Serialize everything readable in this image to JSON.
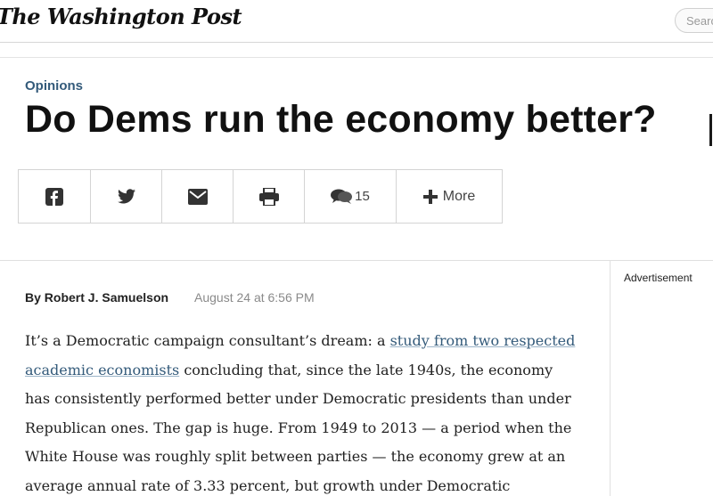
{
  "masthead": {
    "logo_text": "The Washington Post",
    "search_placeholder": "Search"
  },
  "article": {
    "section": "Opinions",
    "headline": "Do Dems run the economy better?",
    "author": "By Robert J. Samuelson",
    "timestamp": "August 24 at 6:56 PM",
    "body": [
      "It’s a Democratic campaign consultant’s dream: a ",
      "study from two respected academic economists",
      " concluding that, since the late 1940s, the economy has consistently performed better under Democratic presidents than under Republican ones. The gap is huge. From 1949 to 2013 — a period when the White House was roughly split between parties — the economy grew at an average annual rate of 3.33 percent, but growth under Democratic"
    ]
  },
  "share_bar": {
    "comment_count": "15",
    "more_label": "More",
    "icons": [
      "facebook-icon",
      "twitter-icon",
      "email-icon",
      "print-icon",
      "comments-icon",
      "plus-icon"
    ]
  },
  "sidebar": {
    "ad_label": "Advertisement"
  },
  "colors": {
    "accent": "#335a7a",
    "muted": "#8a8a8a",
    "border": "#d4d4d4"
  }
}
